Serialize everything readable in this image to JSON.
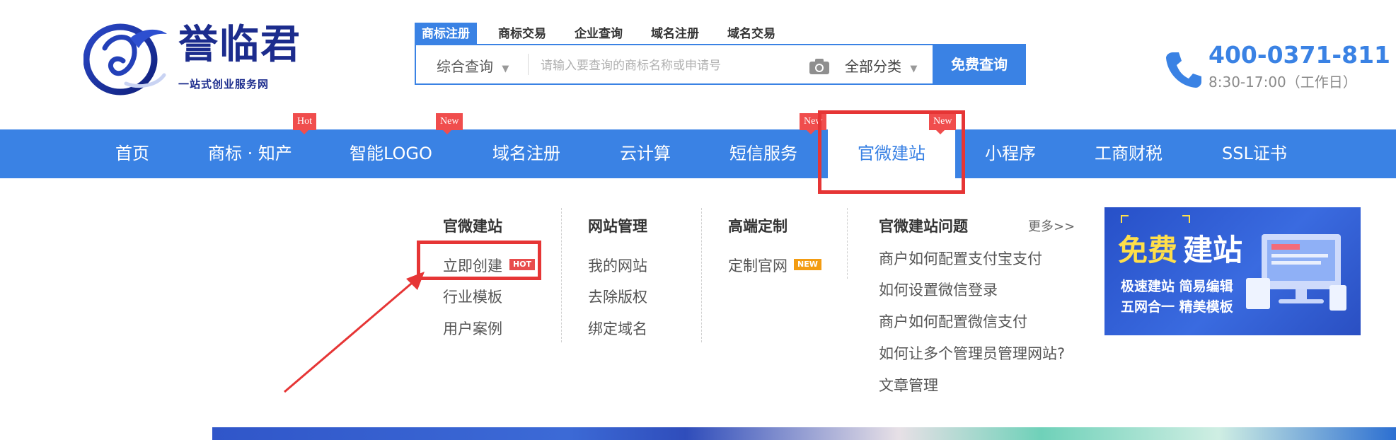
{
  "brand": {
    "name": "誉临君",
    "tagline": "一站式创业服务网",
    "colors": {
      "primary": "#3a82e4",
      "brand_navy": "#1c2c8d",
      "badge_red": "#f04d4d"
    }
  },
  "search": {
    "tabs": [
      "商标注册",
      "商标交易",
      "企业查询",
      "域名注册",
      "域名交易"
    ],
    "active_tab": "商标注册",
    "category": "综合查询",
    "placeholder": "请输入要查询的商标名称或申请号",
    "all_categories": "全部分类",
    "button": "免费查询",
    "icons": [
      "camera-icon",
      "chevron-down-icon"
    ]
  },
  "contact": {
    "phone": "400-0371-811",
    "hours": "8:30-17:00（工作日）",
    "icon": "phone-icon"
  },
  "nav": {
    "items": [
      "首页",
      "商标 · 知产",
      "智能LOGO",
      "域名注册",
      "云计算",
      "短信服务",
      "官微建站",
      "小程序",
      "工商财税",
      "SSL证书"
    ],
    "active": "官微建站",
    "badges": {
      "hot": "Hot",
      "new1": "New",
      "new2": "New",
      "new3": "New"
    }
  },
  "dropdown": {
    "col1": {
      "title": "官微建站",
      "links": [
        "立即创建",
        "行业模板",
        "用户案例"
      ],
      "hot_tag": "HOT"
    },
    "col2": {
      "title": "网站管理",
      "links": [
        "我的网站",
        "去除版权",
        "绑定域名"
      ]
    },
    "col3": {
      "title": "高端定制",
      "links": [
        "定制官网"
      ],
      "new_tag": "NEW"
    },
    "col4": {
      "title": "官微建站问题",
      "more": "更多>>",
      "links": [
        "商户如何配置支付宝支付",
        "如何设置微信登录",
        "商户如何配置微信支付",
        "如何让多个管理员管理网站?",
        "文章管理"
      ]
    }
  },
  "banner": {
    "title_a": "免费",
    "title_b": "建站",
    "line1": "极速建站  简易编辑",
    "line2": "五网合一  精美模板"
  }
}
